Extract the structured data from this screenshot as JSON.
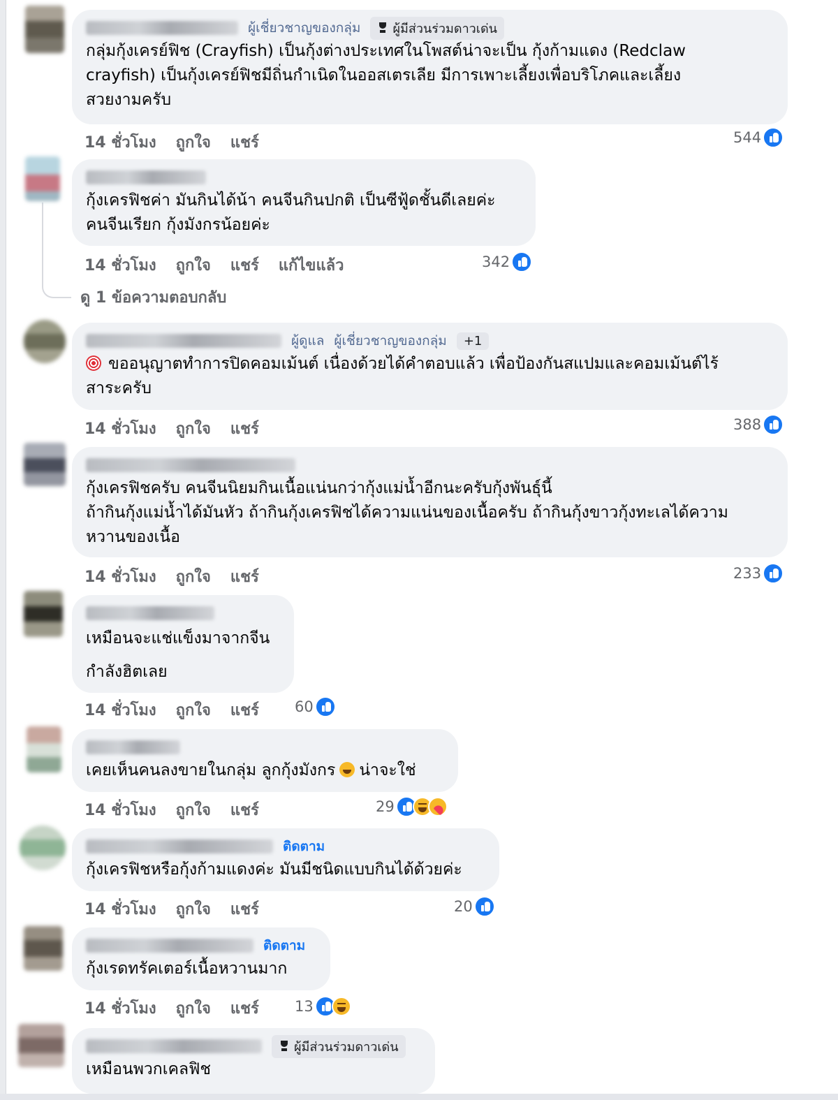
{
  "comments": [
    {
      "badges": [
        {
          "label": "ผู้เชี่ยวชาญของกลุ่ม"
        },
        {
          "label": "ผู้มีส่วนร่วมดาวเด่น",
          "icon": "trophy-icon"
        }
      ],
      "text": "กลุ่มกุ้งเครย์ฟิช (Crayfish) เป็นกุ้งต่างประเทศในโพสต์น่าจะเป็น กุ้งก้ามแดง (Redclaw\ncrayfish) เป็นกุ้งเครย์ฟิชมีถิ่นกำเนิดในออสเตรเลีย มีการเพาะเลี้ยงเพื่อบริโภคและเลี้ยง\nสวยงามครับ",
      "time": "14 ชั่วโมง",
      "like": "ถูกใจ",
      "share": "แชร์",
      "reaction_count": "544",
      "reactions": [
        "like-icon"
      ]
    },
    {
      "badges": [],
      "text": "กุ้งเครฟิชค่า มันกินได้น้า คนจีนกินปกติ เป็นซีฟู้ดชั้นดีเลยค่ะ\nคนจีนเรียก กุ้งมังกรน้อยค่ะ",
      "time": "14 ชั่วโมง",
      "like": "ถูกใจ",
      "share": "แชร์",
      "edited": "แก้ไขแล้ว",
      "reaction_count": "342",
      "reactions": [
        "like-icon"
      ]
    },
    {
      "badges": [
        {
          "label": "ผู้ดูแล"
        },
        {
          "label": "ผู้เชี่ยวชาญของกลุ่ม"
        },
        {
          "label": "+1",
          "grey": true
        }
      ],
      "text": "ขออนุญาตทำการปิดคอมเม้นต์ เนื่องด้วยได้คำตอบแล้ว เพื่อป้องกันสแปมและคอมเม้นต์ไร้\nสาระครับ",
      "time": "14 ชั่วโมง",
      "like": "ถูกใจ",
      "share": "แชร์",
      "reaction_count": "388",
      "reactions": [
        "like-icon"
      ]
    },
    {
      "badges": [],
      "text": "กุ้งเครฟิชครับ คนจีนนิยมกินเนื้อแน่นกว่ากุ้งแม่น้ำอีกนะครับกุ้งพันธุ์นี้\nถ้ากินกุ้งแม่น้ำได้มันหัว ถ้ากินกุ้งเครฟิชได้ความแน่นของเนื้อครับ ถ้ากินกุ้งขาวกุ้งทะเลได้ความ\nหวานของเนื้อ",
      "time": "14 ชั่วโมง",
      "like": "ถูกใจ",
      "share": "แชร์",
      "reaction_count": "233",
      "reactions": [
        "like-icon"
      ]
    },
    {
      "badges": [],
      "text": "เหมือนจะแช่แข็งมาจากจีน\n\nกำลังฮิตเลย",
      "time": "14 ชั่วโมง",
      "like": "ถูกใจ",
      "share": "แชร์",
      "reaction_count": "60",
      "reactions": [
        "like-icon"
      ]
    },
    {
      "badges": [],
      "text_before": "เคยเห็นคนลงขายในกลุ่ม ลูกกุ้งมังกร",
      "text_after": "น่าจะใช่",
      "time": "14 ชั่วโมง",
      "like": "ถูกใจ",
      "share": "แชร์",
      "reaction_count": "29",
      "reactions": [
        "like-icon",
        "haha-icon",
        "care-icon"
      ]
    },
    {
      "badges": [
        {
          "label": "ติดตาม",
          "follow": true
        }
      ],
      "text": "กุ้งเครฟิชหรือกุ้งก้ามแดงค่ะ มันมีชนิดแบบกินได้ด้วยค่ะ",
      "time": "14 ชั่วโมง",
      "like": "ถูกใจ",
      "share": "แชร์",
      "reaction_count": "20",
      "reactions": [
        "like-icon"
      ]
    },
    {
      "badges": [
        {
          "label": "ติดตาม",
          "follow": true
        }
      ],
      "text": "กุ้งเรดทรัคเตอร์เนื้อหวานมาก",
      "time": "14 ชั่วโมง",
      "like": "ถูกใจ",
      "share": "แชร์",
      "reaction_count": "13",
      "reactions": [
        "like-icon",
        "haha-icon"
      ]
    },
    {
      "badges": [
        {
          "label": "ผู้มีส่วนร่วมดาวเด่น",
          "icon": "trophy-icon",
          "grey": true
        }
      ],
      "text": "เหมือนพวกเคลฟิช"
    }
  ],
  "view_replies": "ดู 1 ข้อความตอบกลับ",
  "colors": {
    "bubble": "#f0f2f5",
    "meta": "#65676b",
    "like": "#1877f2",
    "link": "#536a92"
  }
}
